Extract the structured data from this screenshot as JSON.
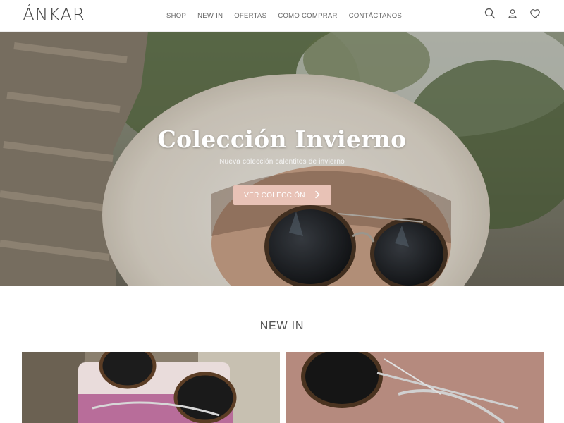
{
  "brand": {
    "logo_text": "ÁNKAR"
  },
  "nav": {
    "items": [
      {
        "label": "SHOP"
      },
      {
        "label": "NEW IN"
      },
      {
        "label": "OFERTAS"
      },
      {
        "label": "COMO COMPRAR"
      },
      {
        "label": "CONTÁCTANOS"
      }
    ]
  },
  "header_icons": [
    "search-icon",
    "user-icon",
    "heart-icon"
  ],
  "hero": {
    "title": "Colección Invierno",
    "subtitle": "Nueva colección calentitos de invierno",
    "button_label": "VER COLECCIÓN",
    "button_icon": "chevron-right-icon"
  },
  "section": {
    "title": "NEW IN"
  },
  "colors": {
    "accent": "#e8c2b6",
    "text": "#3a3a3a",
    "nav_text": "#666666"
  }
}
